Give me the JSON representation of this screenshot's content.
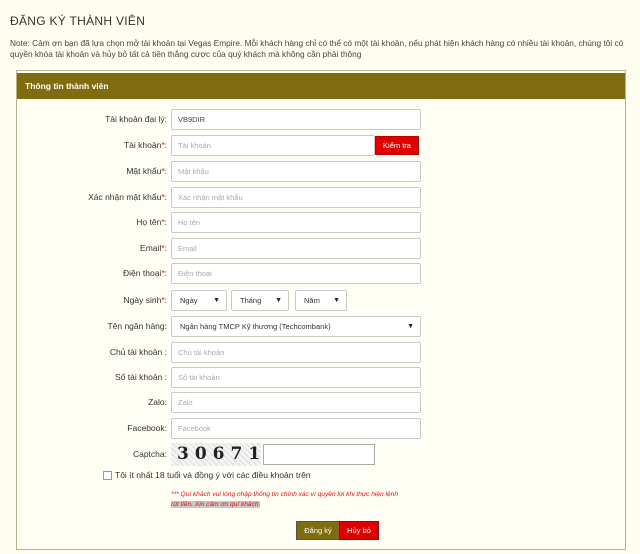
{
  "page": {
    "title": "ĐĂNG KÝ THÀNH VIÊN",
    "note": "Note: Cảm ơn bạn đã lựa chọn mở tài khoản tại Vegas Empire. Mỗi khách hàng chỉ có thể có một tài khoản, nếu phát hiện khách hàng có nhiều tài khoản, chúng tôi có quyền khóa tài khoản và hủy bỏ tất cả tiền thắng cược của quý khách mà không cần phải thông"
  },
  "panel": {
    "header": "Thông tin thành viên"
  },
  "form": {
    "agent": {
      "label": "Tài khoản đại lý:",
      "value": "VB9DIR"
    },
    "username": {
      "label": "Tài khoản",
      "suffix": ":",
      "placeholder": "Tài khoản",
      "check_button": "Kiểm tra"
    },
    "password": {
      "label": "Mật khẩu",
      "suffix": ":",
      "placeholder": "Mật khẩu"
    },
    "confirm_password": {
      "label": "Xác nhận mật khẩu",
      "suffix": ":",
      "placeholder": "Xác nhận mật khẩu"
    },
    "fullname": {
      "label": "Họ tên",
      "suffix": ":",
      "placeholder": "Họ tên"
    },
    "email": {
      "label": "Email",
      "suffix": ":",
      "placeholder": "Email"
    },
    "phone": {
      "label": "Điện thoại",
      "suffix": ":",
      "placeholder": "Điện thoại"
    },
    "birthday": {
      "label": "Ngày sinh",
      "suffix": ":",
      "day": "Ngày",
      "month": "Tháng",
      "year": "Năm"
    },
    "bank": {
      "label": "Tên ngân hàng:",
      "selected": "Ngân hàng TMCP Kỹ thương (Techcombank)"
    },
    "account_holder": {
      "label": "Chủ tài khoản :",
      "placeholder": "Chủ tài khoản"
    },
    "account_number": {
      "label": "Số tài khoản :",
      "placeholder": "Số tài khoản"
    },
    "zalo": {
      "label": "Zalo:",
      "placeholder": "Zalo"
    },
    "facebook": {
      "label": "Facebook:",
      "placeholder": "Facebook"
    },
    "captcha": {
      "label": "Captcha:",
      "code": "30671"
    },
    "agree": {
      "label": "Tôi ít nhất 18 tuổi và đồng ý với các điều khoản trên"
    },
    "warning_line1": "*** Quí khách vui lòng nhập thông tin chính xác vì quyền lợi khi thực hiện lệnh",
    "warning_line2": "rút tiền. Xin cảm ơn quí khách."
  },
  "buttons": {
    "register": "Đăng ký",
    "cancel": "Hủy bỏ"
  },
  "colors": {
    "header": "#7f6c10",
    "danger": "#e00000",
    "required": "#dd1111"
  },
  "icons": {
    "select_arrow": "caret-down-icon"
  }
}
